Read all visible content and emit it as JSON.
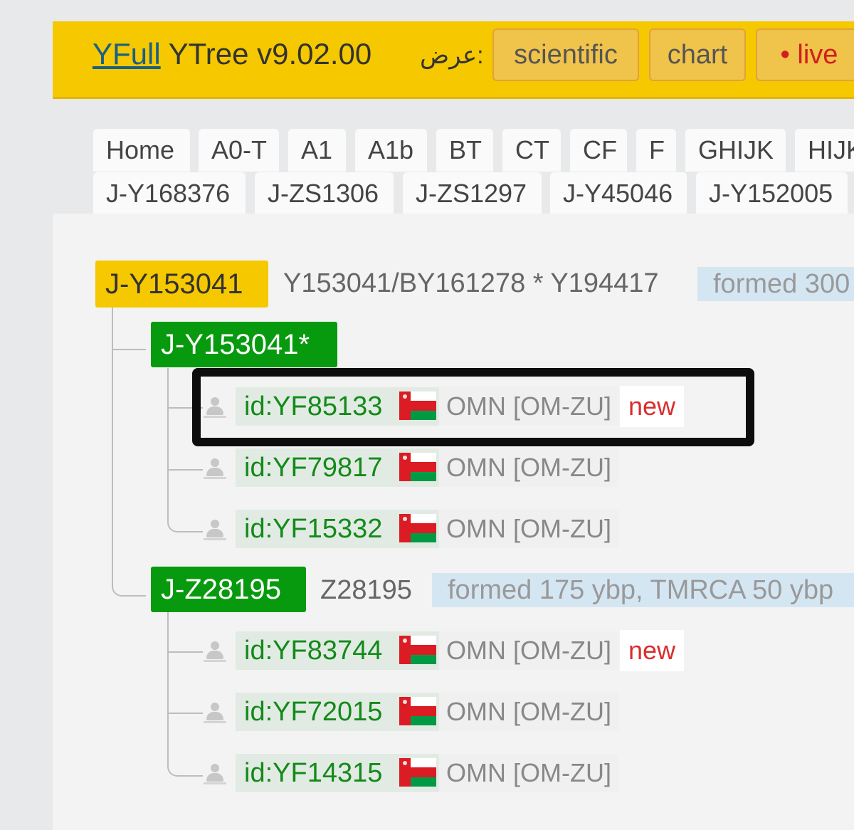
{
  "header": {
    "brand_link": "YFull",
    "brand_rest": " YTree v9.02.00",
    "view_label": "عرض:",
    "buttons": {
      "scientific": "scientific",
      "chart": "chart",
      "live": "• live"
    }
  },
  "tabs_row1": [
    "Home",
    "A0-T",
    "A1",
    "A1b",
    "BT",
    "CT",
    "CF",
    "F",
    "GHIJK",
    "HIJK"
  ],
  "tabs_row2": [
    "J-Y168376",
    "J-ZS1306",
    "J-ZS1297",
    "J-Y45046",
    "J-Y152005"
  ],
  "tree": {
    "root": {
      "name": "J-Y153041",
      "snps": "Y153041/BY161278 * Y194417",
      "info": "formed 300"
    },
    "branch1": {
      "name": "J-Y153041*",
      "samples": [
        {
          "id": "id:YF85133",
          "country": "OMN [OM-ZU]",
          "badge": "new"
        },
        {
          "id": "id:YF79817",
          "country": "OMN [OM-ZU]"
        },
        {
          "id": "id:YF15332",
          "country": "OMN [OM-ZU]"
        }
      ]
    },
    "branch2": {
      "name": "J-Z28195",
      "snps": "Z28195",
      "info": "formed 175 ybp, TMRCA 50 ybp",
      "samples": [
        {
          "id": "id:YF83744",
          "country": "OMN [OM-ZU]",
          "badge": "new"
        },
        {
          "id": "id:YF72015",
          "country": "OMN [OM-ZU]"
        },
        {
          "id": "id:YF14315",
          "country": "OMN [OM-ZU]"
        }
      ]
    }
  },
  "colors": {
    "header_bg": "#f5c800",
    "branch_green": "#079a0e",
    "sample_id_green": "#138a1a",
    "new_red": "#d92d2d",
    "info_blue": "#d5e6f3",
    "oman_red": "#db1c24",
    "oman_green": "#009a44"
  }
}
